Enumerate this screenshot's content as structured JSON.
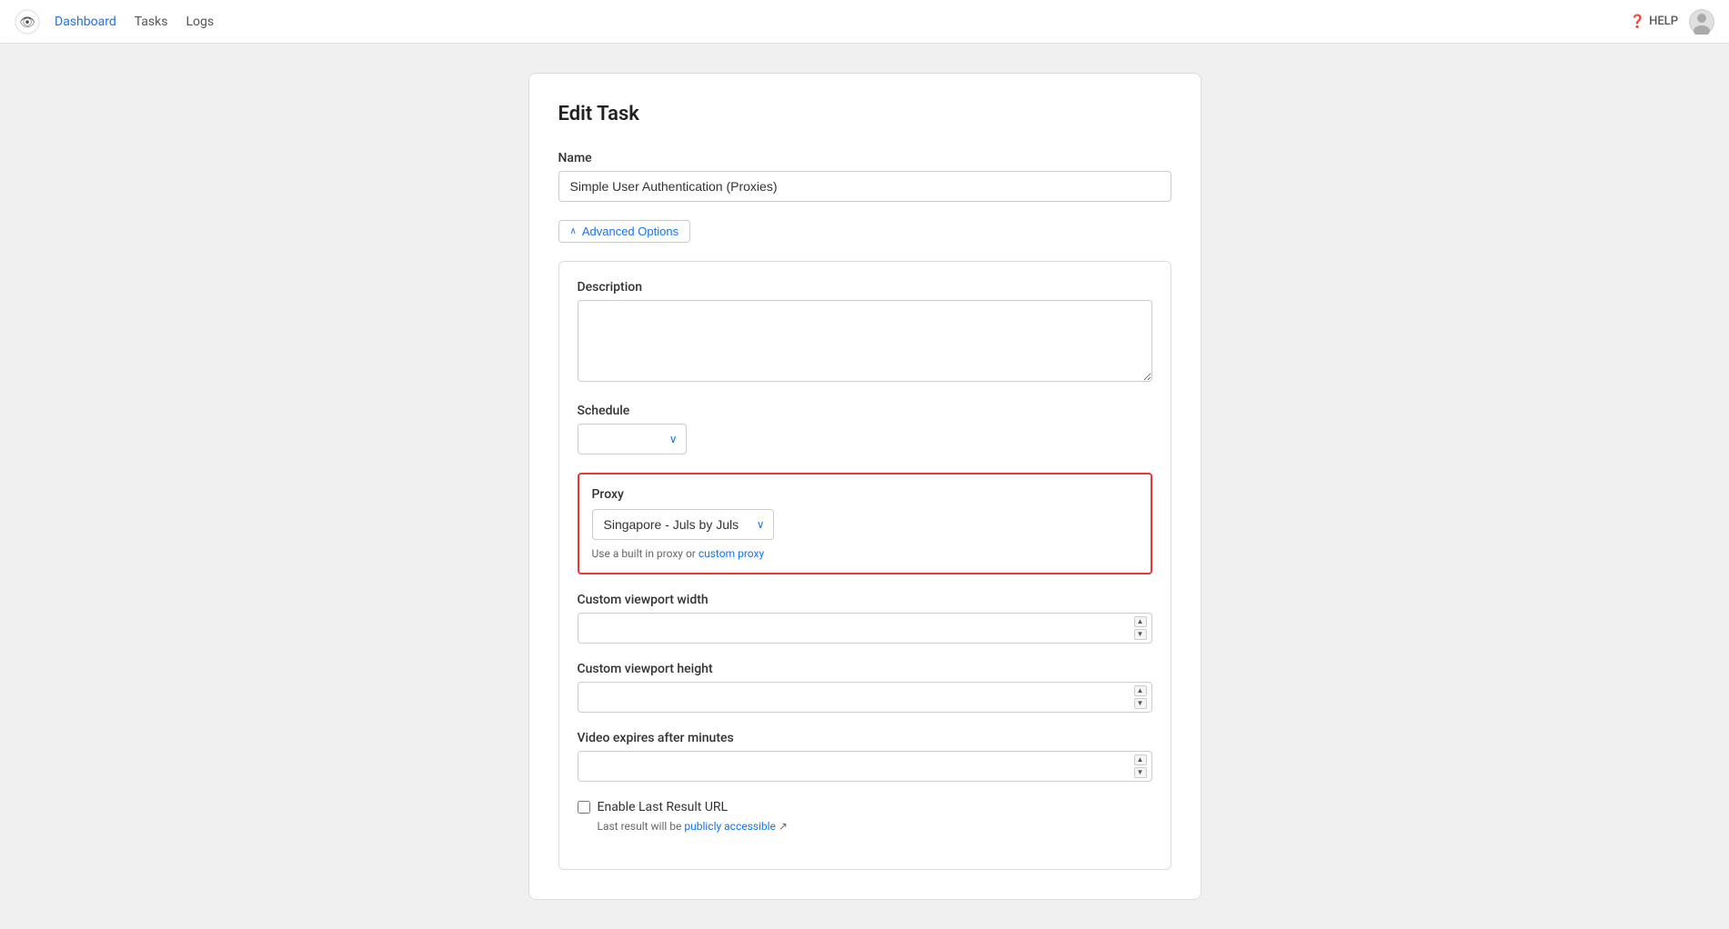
{
  "navbar": {
    "logo_alt": "App Logo",
    "links": [
      {
        "label": "Dashboard",
        "href": "#",
        "active": true
      },
      {
        "label": "Tasks",
        "href": "#",
        "active": false
      },
      {
        "label": "Logs",
        "href": "#",
        "active": false
      }
    ],
    "help_label": "HELP",
    "avatar_initials": ""
  },
  "page": {
    "title": "Edit Task"
  },
  "form": {
    "name_label": "Name",
    "name_value": "Simple User Authentication (Proxies)",
    "name_placeholder": "",
    "advanced_options_label": "Advanced Options",
    "description_label": "Description",
    "description_value": "",
    "description_placeholder": "",
    "schedule_label": "Schedule",
    "schedule_value": "",
    "schedule_placeholder": "",
    "proxy_label": "Proxy",
    "proxy_value": "Singapore - Juls by Juls",
    "proxy_helper_text": "Use a built in proxy or ",
    "proxy_helper_link": "custom proxy",
    "custom_viewport_width_label": "Custom viewport width",
    "custom_viewport_width_value": "",
    "custom_viewport_height_label": "Custom viewport height",
    "custom_viewport_height_value": "",
    "video_expires_label": "Video expires after minutes",
    "video_expires_value": "",
    "enable_last_result_label": "Enable Last Result URL",
    "last_result_helper_pre": "Last result will be ",
    "last_result_helper_link": "publicly accessible",
    "last_result_helper_post": " ↗"
  },
  "icons": {
    "chevron_up": "∧",
    "chevron_down": "∨",
    "question": "?",
    "spinner_up": "▲",
    "spinner_down": "▼"
  }
}
